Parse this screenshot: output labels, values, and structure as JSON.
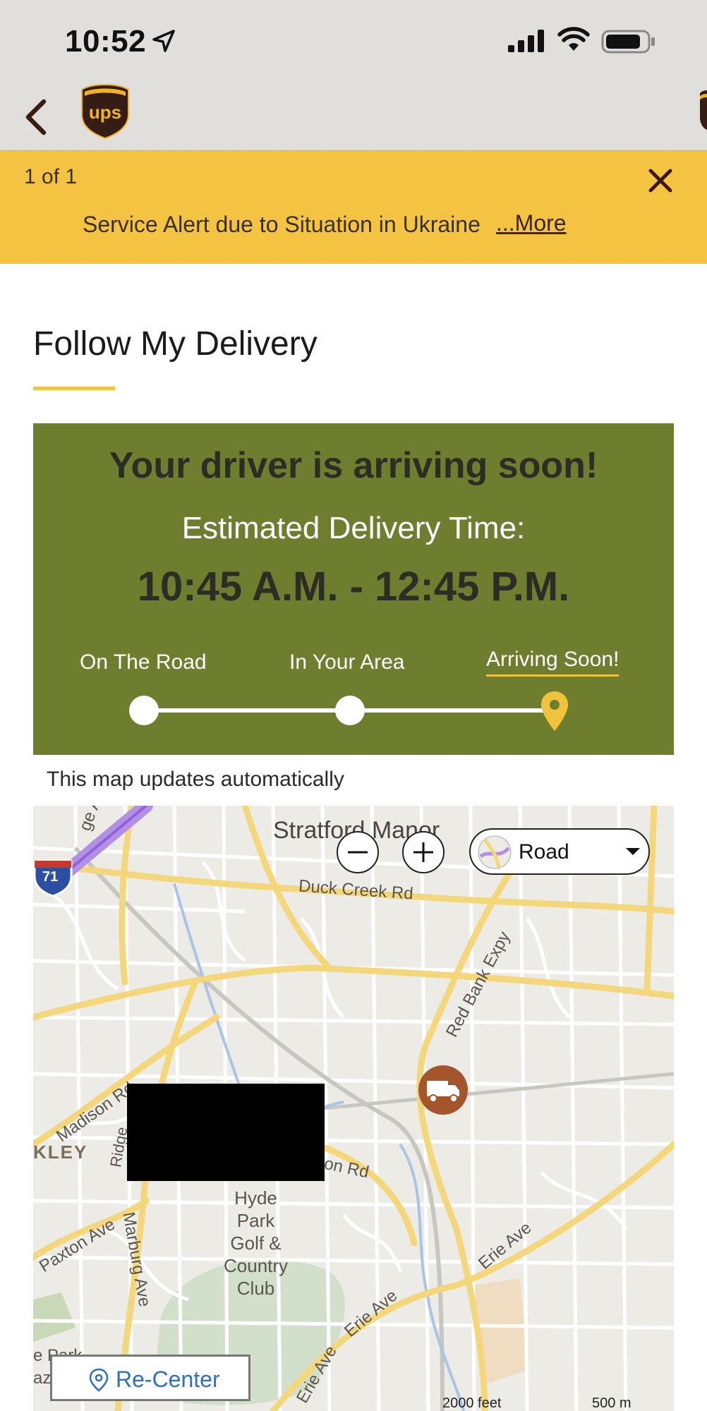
{
  "status_bar": {
    "time": "10:52"
  },
  "nav": {
    "logo_text": "ups"
  },
  "alert": {
    "count": "1 of 1",
    "text": "Service Alert due to Situation in Ukraine",
    "more_link": "...More"
  },
  "page": {
    "title": "Follow My Delivery"
  },
  "delivery": {
    "headline": "Your driver is arriving soon!",
    "eta_label": "Estimated Delivery Time:",
    "eta_time": "10:45 A.M. - 12:45 P.M.",
    "steps": [
      {
        "label": "On The Road",
        "active": false
      },
      {
        "label": "In Your Area",
        "active": false
      },
      {
        "label": "Arriving Soon!",
        "active": true
      }
    ]
  },
  "map": {
    "note": "This map updates automatically",
    "map_type": "Road",
    "recenter_label": "Re-Center",
    "scale_feet": "2000 feet",
    "scale_meters": "500 m",
    "labels": {
      "stratford": "Stratford Manor",
      "duck_creek": "Duck Creek Rd",
      "red_bank": "Red Bank Expy",
      "madison": "Madison Rd",
      "kley": "KLEY",
      "ridge": "Ridge",
      "on_rd": "on Rd",
      "hyde_park": "Hyde\nPark\nGolf &\nCountry\nClub",
      "paxton": "Paxton Ave",
      "marburg": "Marburg Ave",
      "erie_1": "Erie Ave",
      "erie_2": "Erie Ave",
      "erie_3": "Erie Ave",
      "erie_4": "Erie Ave",
      "ge_ave": "ge Ave",
      "park": "e Park",
      "aza": "aza",
      "interstate": "71"
    }
  },
  "colors": {
    "ups_brown": "#351c15",
    "ups_gold": "#f0b323",
    "alert_bg": "#f5c342",
    "card_bg": "#6f7d2f",
    "truck_marker": "#a5552b",
    "link_blue": "#2d6fc1"
  }
}
